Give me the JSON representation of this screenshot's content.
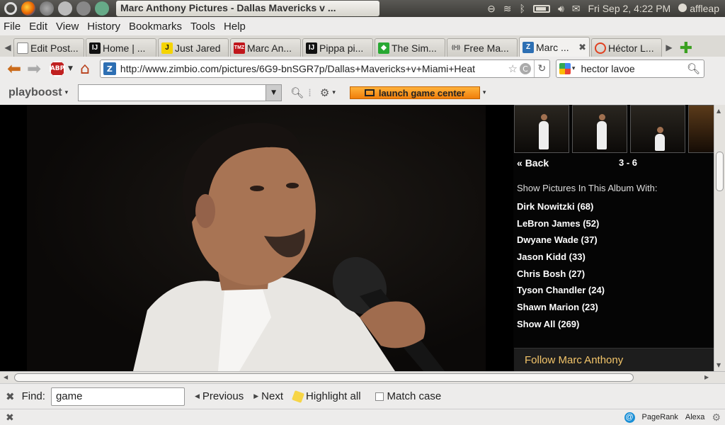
{
  "panel": {
    "window_title": "Marc Anthony Pictures - Dallas Mavericks v ...",
    "clock": "Fri Sep  2,  4:22 PM",
    "user": "affleap"
  },
  "menubar": [
    "File",
    "Edit",
    "View",
    "History",
    "Bookmarks",
    "Tools",
    "Help"
  ],
  "tabs": [
    {
      "label": "Edit Post...",
      "favicon": "page-icon",
      "color": "#ffffff",
      "glyph": ""
    },
    {
      "label": "Home | ...",
      "favicon": "ij-icon",
      "color": "#111111",
      "glyph": "IJ"
    },
    {
      "label": "Just Jared",
      "favicon": "jj-icon",
      "color": "#f5d400",
      "glyph": "J"
    },
    {
      "label": "Marc An...",
      "favicon": "tmz-icon",
      "color": "#c0161b",
      "glyph": "TMZ"
    },
    {
      "label": "Pippa pi...",
      "favicon": "ij-icon",
      "color": "#111111",
      "glyph": "IJ"
    },
    {
      "label": "The Sim...",
      "favicon": "sims-icon",
      "color": "#27a832",
      "glyph": "◆"
    },
    {
      "label": "Free Ma...",
      "favicon": "radio-icon",
      "color": "#ffffff",
      "glyph": "((•))"
    },
    {
      "label": "Marc ...",
      "favicon": "zimbio-icon",
      "color": "#2d6fb3",
      "glyph": "Z",
      "active": true
    },
    {
      "label": "Héctor L...",
      "favicon": "spinner-icon",
      "color": "#e04020",
      "glyph": "C"
    }
  ],
  "nav": {
    "url": "http://www.zimbio.com/pictures/6G9-bnSGR7p/Dallas+Mavericks+v+Miami+Heat",
    "search": "hector lavoe",
    "abp": "ABP"
  },
  "toolbar2": {
    "logo": "playboost",
    "launch_label": "launch game center"
  },
  "sidebar": {
    "back": "Back",
    "range": "3 - 6",
    "heading": "Show Pictures In This Album With:",
    "items": [
      "Dirk Nowitzki (68)",
      "LeBron James (52)",
      "Dwyane Wade (37)",
      "Jason Kidd (33)",
      "Chris Bosh (27)",
      "Tyson Chandler (24)",
      "Shawn Marion (23)",
      "Show All (269)"
    ],
    "follow": "Follow Marc Anthony"
  },
  "findbar": {
    "label": "Find:",
    "value": "game",
    "previous": "Previous",
    "next": "Next",
    "highlight": "Highlight all",
    "match_case": "Match case"
  },
  "statusbar": {
    "pagerank": "PageRank",
    "alexa": "Alexa"
  },
  "colors": {
    "panel_bg": "#3c3b37",
    "accent_orange": "#f07e0a",
    "follow_text": "#f3c56a"
  }
}
